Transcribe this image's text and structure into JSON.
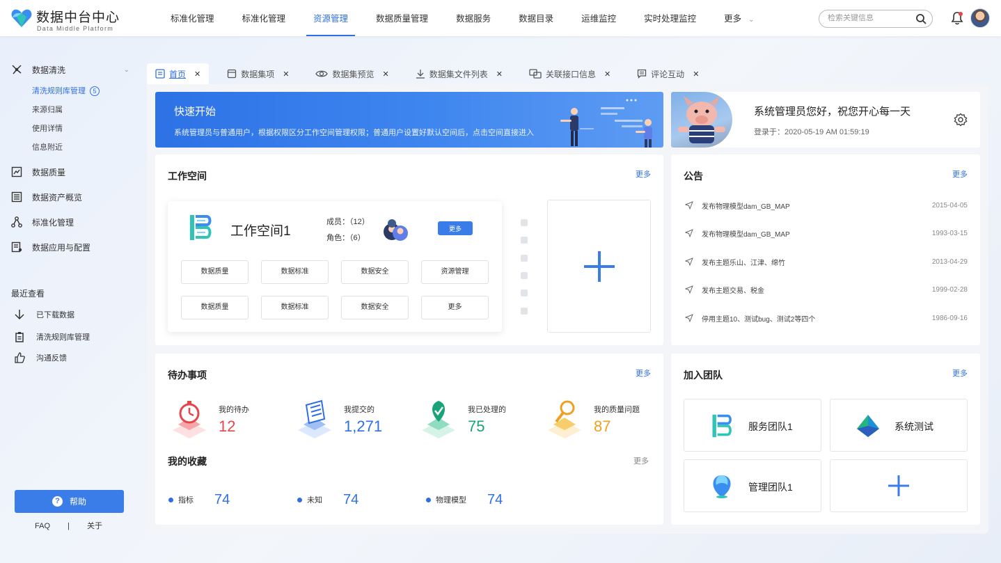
{
  "app": {
    "title": "数据中台中心",
    "subtitle": "Data Middle Platform"
  },
  "nav": {
    "items": [
      "标准化管理",
      "标准化管理",
      "资源管理",
      "数据质量管理",
      "数据服务",
      "数据目录",
      "运维监控",
      "实时处理监控",
      "更多"
    ],
    "active_index": 2
  },
  "search": {
    "placeholder": "检索关键信息"
  },
  "sidebar": {
    "groups": [
      {
        "label": "数据清洗",
        "subs": [
          {
            "label": "清洗规则库管理",
            "badge": "5"
          },
          {
            "label": "来源归属"
          },
          {
            "label": "使用详情"
          },
          {
            "label": "信息附近"
          }
        ]
      },
      {
        "label": "数据质量"
      },
      {
        "label": "数据资产概览"
      },
      {
        "label": "标准化管理"
      },
      {
        "label": "数据应用与配置"
      }
    ],
    "recent_title": "最近查看",
    "recent": [
      "已下载数据",
      "清洗规则库管理",
      "沟通反馈"
    ],
    "help_label": "帮助",
    "faq": "FAQ",
    "divider": "|",
    "about": "关于"
  },
  "tabs": [
    {
      "label": "首页",
      "icon": "home-doc-icon"
    },
    {
      "label": "数据集项",
      "icon": "dataset-icon"
    },
    {
      "label": "数据集预览",
      "icon": "eye-icon"
    },
    {
      "label": "数据集文件列表",
      "icon": "download-icon"
    },
    {
      "label": "关联接口信息",
      "icon": "link-icon"
    },
    {
      "label": "评论互动",
      "icon": "comment-icon"
    }
  ],
  "banner": {
    "title": "快速开始",
    "desc": "系统管理员与普通用户，根据权限区分工作空间管理权限；普通用户设置好默认空间后，点击空间直接进入"
  },
  "profile": {
    "greeting": "系统管理员您好，祝您开心每一天",
    "login": "登录于：2020-05-19  AM 01:59:19"
  },
  "workspace": {
    "title": "工作空间",
    "more": "更多",
    "name": "工作空间1",
    "members": "成员：（12）",
    "roles": "角色：（6）",
    "more_btn": "更多",
    "tags": [
      "数据质量",
      "数据标准",
      "数据安全",
      "资源管理",
      "数据质量",
      "数据标准",
      "数据安全",
      "更多"
    ]
  },
  "notice": {
    "title": "公告",
    "more": "更多",
    "items": [
      {
        "text": "发布物理模型dam_GB_MAP",
        "date": "2015-04-05"
      },
      {
        "text": "发布物理模型dam_GB_MAP",
        "date": "1993-03-15"
      },
      {
        "text": "发布主题乐山、江津、绵竹",
        "date": "2013-04-29"
      },
      {
        "text": "发布主题交易、税金",
        "date": "1999-02-28"
      },
      {
        "text": "停用主题10、测试bug、测试2等四个",
        "date": "1986-09-16"
      }
    ]
  },
  "todo": {
    "title": "待办事项",
    "more": "更多",
    "items": [
      {
        "label": "我的待办",
        "value": "12",
        "color": "#e8454b"
      },
      {
        "label": "我提交的",
        "value": "1,271",
        "color": "#2f6fe4"
      },
      {
        "label": "我已处理的",
        "value": "75",
        "color": "#1aa37a"
      },
      {
        "label": "我的质量问题",
        "value": "87",
        "color": "#f0a020"
      }
    ]
  },
  "favorites": {
    "title": "我的收藏",
    "more": "更多",
    "items": [
      {
        "label": "指标",
        "value": "74"
      },
      {
        "label": "未知",
        "value": "74"
      },
      {
        "label": "物理模型",
        "value": "74"
      }
    ]
  },
  "teams": {
    "title": "加入团队",
    "more": "更多",
    "items": [
      {
        "name": "服务团队1"
      },
      {
        "name": "系统测试"
      },
      {
        "name": "管理团队1"
      }
    ]
  },
  "colors": {
    "accent": "#2f6fe4",
    "banner_start": "#2d72e6",
    "banner_end": "#5e9cf3"
  }
}
